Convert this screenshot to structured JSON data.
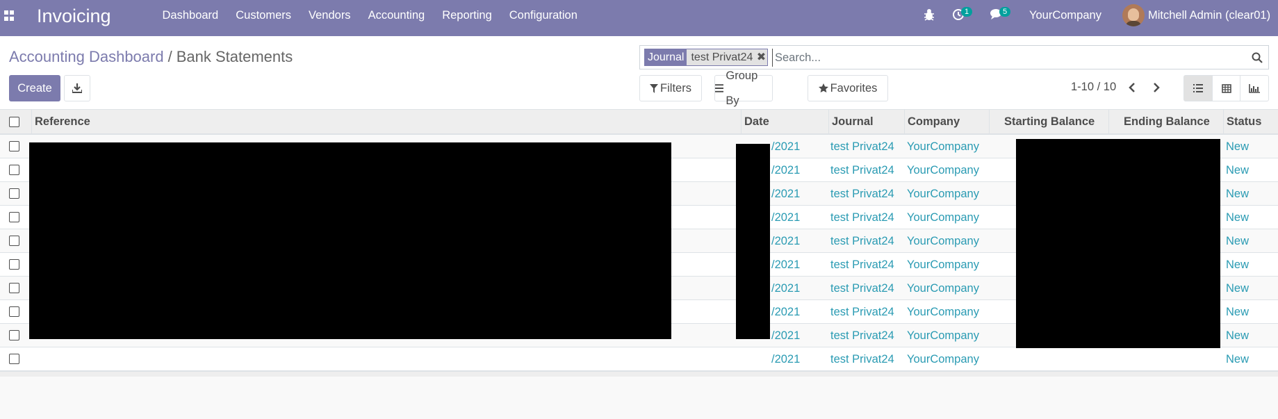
{
  "navbar": {
    "app_name": "Invoicing",
    "menu": [
      "Dashboard",
      "Customers",
      "Vendors",
      "Accounting",
      "Reporting",
      "Configuration"
    ],
    "activity_badge": "1",
    "messages_badge": "5",
    "company": "YourCompany",
    "user": "Mitchell Admin (clear01)"
  },
  "breadcrumb": {
    "parent": "Accounting Dashboard",
    "separator": "/",
    "current": "Bank Statements"
  },
  "toolbar": {
    "create_label": "Create",
    "filters_label": "Filters",
    "group_by_label": "Group By",
    "favorites_label": "Favorites",
    "pager": "1-10 / 10"
  },
  "search": {
    "facet_label": "Journal",
    "facet_value": "test Privat24",
    "placeholder": "Search..."
  },
  "table": {
    "columns": [
      "Reference",
      "Date",
      "Journal",
      "Company",
      "Starting Balance",
      "Ending Balance",
      "Status"
    ],
    "rows": [
      {
        "date": "/2021",
        "journal": "test Privat24",
        "company": "YourCompany",
        "status": "New"
      },
      {
        "date": "/2021",
        "journal": "test Privat24",
        "company": "YourCompany",
        "status": "New"
      },
      {
        "date": "/2021",
        "journal": "test Privat24",
        "company": "YourCompany",
        "status": "New"
      },
      {
        "date": "/2021",
        "journal": "test Privat24",
        "company": "YourCompany",
        "status": "New"
      },
      {
        "date": "/2021",
        "journal": "test Privat24",
        "company": "YourCompany",
        "status": "New"
      },
      {
        "date": "/2021",
        "journal": "test Privat24",
        "company": "YourCompany",
        "status": "New"
      },
      {
        "date": "/2021",
        "journal": "test Privat24",
        "company": "YourCompany",
        "status": "New"
      },
      {
        "date": "/2021",
        "journal": "test Privat24",
        "company": "YourCompany",
        "status": "New"
      },
      {
        "date": "/2021",
        "journal": "test Privat24",
        "company": "YourCompany",
        "status": "New"
      },
      {
        "date": "/2021",
        "journal": "test Privat24",
        "company": "YourCompany",
        "status": "New"
      }
    ]
  },
  "colors": {
    "brand": "#7c7bad",
    "link": "#2a9bb3",
    "badge": "#00a09d"
  }
}
